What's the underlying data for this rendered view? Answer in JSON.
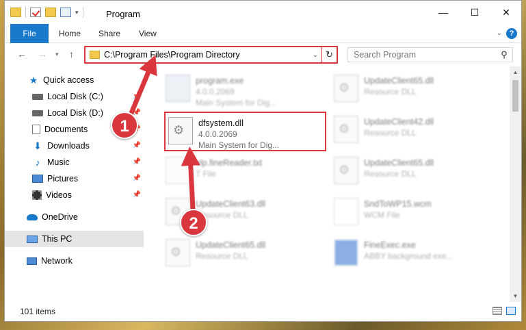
{
  "window": {
    "title": "Program",
    "minimize_glyph": "—",
    "maximize_glyph": "☐",
    "close_glyph": "✕"
  },
  "ribbon": {
    "tabs": [
      "File",
      "Home",
      "Share",
      "View"
    ]
  },
  "navigation": {
    "back_glyph": "←",
    "forward_glyph": "→",
    "recent_glyph": "▾",
    "up_glyph": "↑",
    "address": "C:\\Program Files\\Program Directory",
    "refresh_glyph": "↻",
    "search_placeholder": "Search Program",
    "search_glyph": "⚲"
  },
  "sidebar": {
    "items": [
      {
        "label": "Quick access",
        "icon": "star-icon",
        "pinned": false
      },
      {
        "label": "Local Disk (C:)",
        "icon": "disk-icon",
        "pinned": true
      },
      {
        "label": "Local Disk (D:)",
        "icon": "disk-icon",
        "pinned": true
      },
      {
        "label": "Documents",
        "icon": "documents-icon",
        "pinned": true
      },
      {
        "label": "Downloads",
        "icon": "download-icon",
        "pinned": true
      },
      {
        "label": "Music",
        "icon": "music-icon",
        "pinned": true
      },
      {
        "label": "Pictures",
        "icon": "pictures-icon",
        "pinned": true
      },
      {
        "label": "Videos",
        "icon": "videos-icon",
        "pinned": true
      },
      {
        "label": "OneDrive",
        "icon": "cloud-icon",
        "pinned": false
      },
      {
        "label": "This PC",
        "icon": "computer-icon",
        "pinned": false
      },
      {
        "label": "Network",
        "icon": "network-icon",
        "pinned": false
      }
    ]
  },
  "files": [
    {
      "name": "program.exe",
      "line1": "4.0.0.2069",
      "line2": "Main System for Dig...",
      "icon": "exe-icon"
    },
    {
      "name": "UpdateClient65.dll",
      "line1": "Resource DLL",
      "line2": "",
      "icon": "dll-icon"
    },
    {
      "name": "dfsystem.dll",
      "line1": "4.0.0.2069",
      "line2": "Main System for Dig...",
      "icon": "dll-icon"
    },
    {
      "name": "UpdateClient42.dll",
      "line1": "Resource DLL",
      "line2": "",
      "icon": "dll-icon"
    },
    {
      "name": "elp.fineReader.txt",
      "line1": "T File",
      "line2": "",
      "icon": "txt-icon"
    },
    {
      "name": "UpdateClient65.dll",
      "line1": "Resource DLL",
      "line2": "",
      "icon": "dll-icon"
    },
    {
      "name": "UpdateClient63.dll",
      "line1": "Resource DLL",
      "line2": "",
      "icon": "dll-icon"
    },
    {
      "name": "SndToWP15.wcm",
      "line1": "WCM File",
      "line2": "",
      "icon": "wcm-icon"
    },
    {
      "name": "UpdateClient65.dll",
      "line1": "Resource DLL",
      "line2": "",
      "icon": "dll-icon"
    },
    {
      "name": "FineExec.exe",
      "line1": "ABBY background exe...",
      "line2": "",
      "icon": "fineexec-icon"
    }
  ],
  "status": {
    "item_count": "101 items"
  },
  "annotations": {
    "callout_1": "1",
    "callout_2": "2",
    "color": "#d9363e"
  },
  "colors": {
    "accent": "#1979ca",
    "highlight": "#d9363e"
  }
}
